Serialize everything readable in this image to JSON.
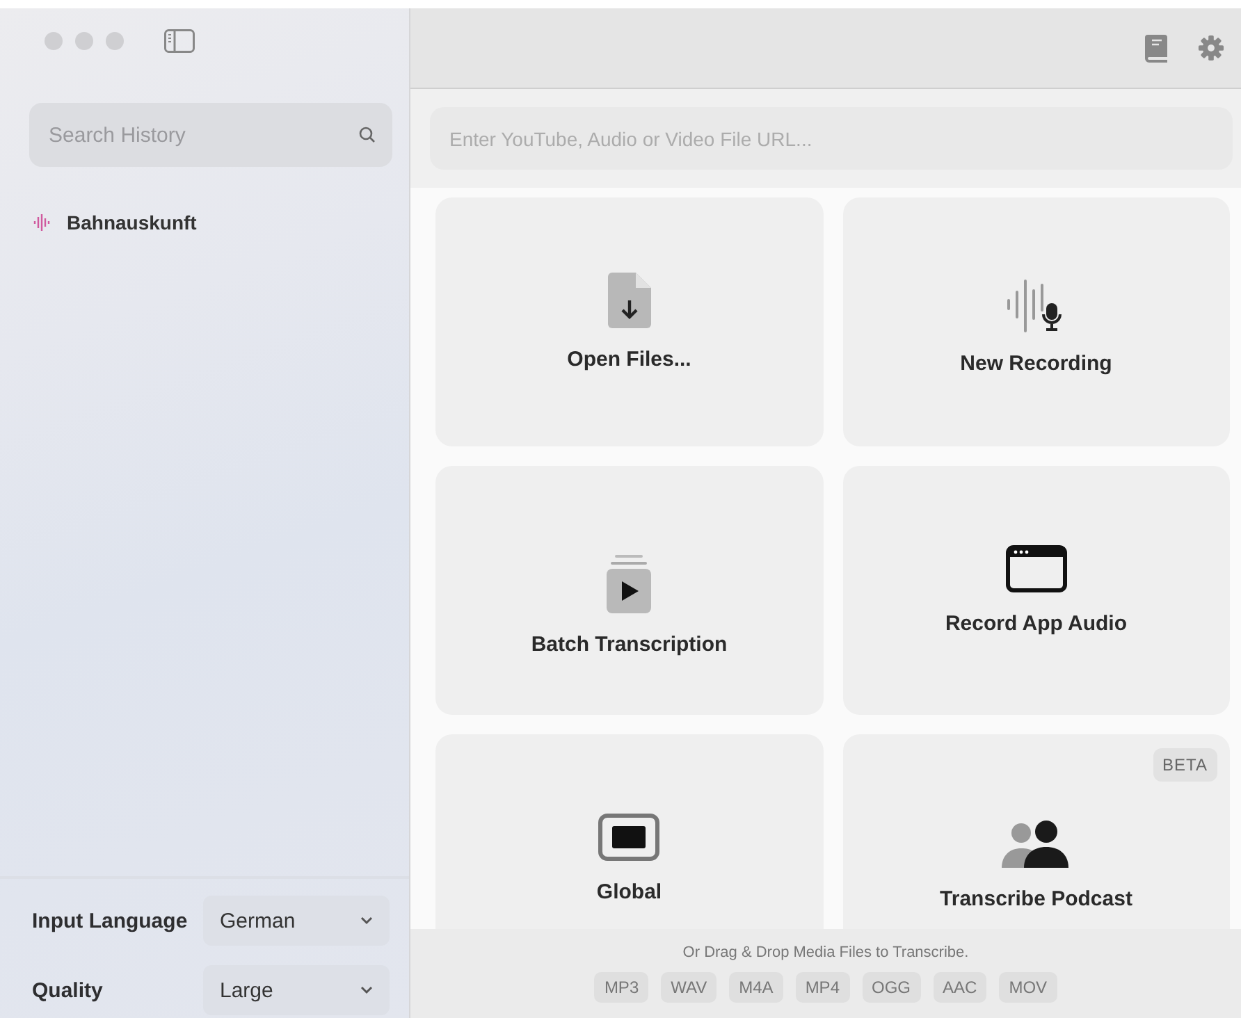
{
  "sidebar": {
    "search": {
      "placeholder": "Search History"
    },
    "history": [
      {
        "title": "Bahnauskunft"
      }
    ],
    "settings": [
      {
        "label": "Input Language",
        "value": "German"
      },
      {
        "label": "Quality",
        "value": "Large"
      }
    ]
  },
  "url_field": {
    "placeholder": "Enter YouTube, Audio or Video File URL..."
  },
  "cards": [
    {
      "kind": "file",
      "label": "Open Files..."
    },
    {
      "kind": "recording",
      "label": "New Recording"
    },
    {
      "kind": "batch",
      "label": "Batch Transcription"
    },
    {
      "kind": "window",
      "label": "Record App Audio"
    },
    {
      "kind": "screen",
      "label": "Global"
    },
    {
      "kind": "podcast",
      "label": "Transcribe Podcast",
      "badge": "BETA"
    }
  ],
  "footer": {
    "hint": "Or Drag & Drop Media Files to Transcribe.",
    "formats": [
      "MP3",
      "WAV",
      "M4A",
      "MP4",
      "OGG",
      "AAC",
      "MOV"
    ]
  }
}
